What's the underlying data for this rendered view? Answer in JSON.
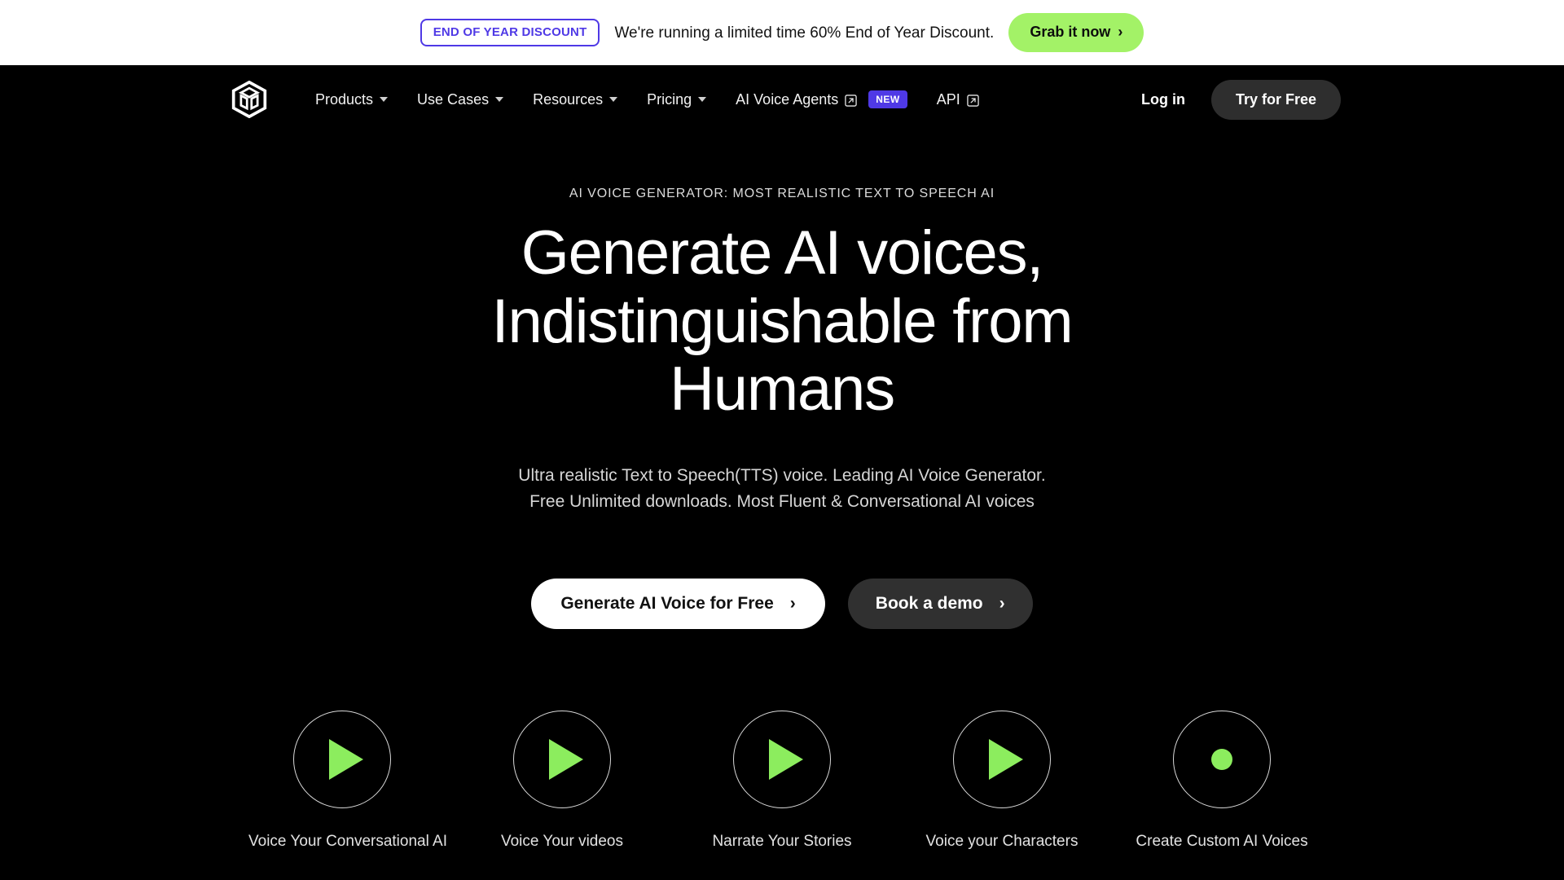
{
  "promo_banner": {
    "tag": "END OF YEAR DISCOUNT",
    "message": "We're running a limited time 60% End of Year Discount.",
    "cta_label": "Grab it now",
    "cta_chevron": "›",
    "tag_color": "#4f39e6",
    "cta_bg": "#a3f267",
    "background": "#ffffff"
  },
  "navbar": {
    "logo_name": "play-cube-logo",
    "items": [
      {
        "label": "Products",
        "has_caret": true,
        "has_external": false,
        "badge": ""
      },
      {
        "label": "Use Cases",
        "has_caret": true,
        "has_external": false,
        "badge": ""
      },
      {
        "label": "Resources",
        "has_caret": true,
        "has_external": false,
        "badge": ""
      },
      {
        "label": "Pricing",
        "has_caret": true,
        "has_external": false,
        "badge": ""
      },
      {
        "label": "AI Voice Agents",
        "has_caret": false,
        "has_external": true,
        "badge": "NEW"
      },
      {
        "label": "API",
        "has_caret": false,
        "has_external": true,
        "badge": ""
      }
    ],
    "login_label": "Log in",
    "try_label": "Try for Free",
    "badge_color": "#4f39e6",
    "try_bg": "#2e2e2e"
  },
  "hero": {
    "eyebrow": "AI VOICE GENERATOR: MOST REALISTIC TEXT TO SPEECH AI",
    "headline": "Generate AI voices, Indistinguishable from Humans",
    "subhead_line1": "Ultra realistic Text to Speech(TTS) voice. Leading AI Voice Generator.",
    "subhead_line2": "Free Unlimited downloads. Most Fluent & Conversational AI voices",
    "primary_cta": "Generate AI Voice for Free",
    "primary_chevron": "›",
    "secondary_cta": "Book a demo",
    "secondary_chevron": "›"
  },
  "features": {
    "accent_color": "#8ced5e",
    "items": [
      {
        "label": "Voice Your Conversational AI",
        "icon": "play-icon"
      },
      {
        "label": "Voice Your videos",
        "icon": "play-icon"
      },
      {
        "label": "Narrate Your Stories",
        "icon": "play-icon"
      },
      {
        "label": "Voice your Characters",
        "icon": "play-icon"
      },
      {
        "label": "Create Custom AI Voices",
        "icon": "record-dot-icon"
      }
    ]
  }
}
